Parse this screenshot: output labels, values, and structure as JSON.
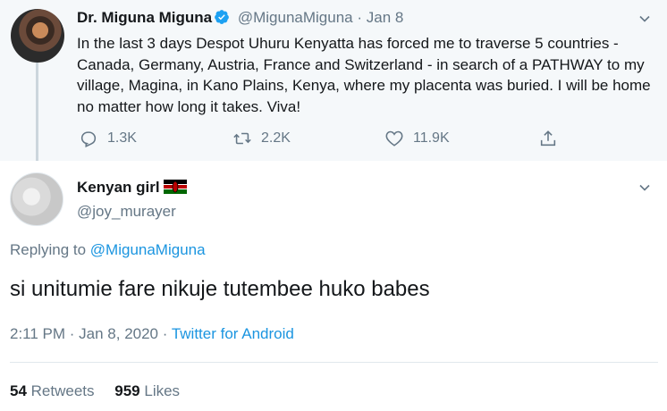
{
  "parent_tweet": {
    "author_name": "Dr. Miguna Miguna",
    "handle": "@MigunaMiguna",
    "separator": "·",
    "date": "Jan 8",
    "text": "In the last 3 days Despot Uhuru Kenyatta has forced me to traverse 5 countries - Canada, Germany, Austria, France and Switzerland - in search of a PATHWAY to my village, Magina, in Kano Plains, Kenya, where my placenta was buried. I will be home no matter how long it takes. Viva!",
    "replies": "1.3K",
    "retweets": "2.2K",
    "likes": "11.9K"
  },
  "reply_tweet": {
    "author_name": "Kenyan girl",
    "handle": "@joy_murayer",
    "replying_prefix": "Replying to",
    "replying_handle": "@MigunaMiguna",
    "text": "si unitumie fare nikuje tutembee huko babes",
    "time": "2:11 PM · Jan 8, 2020 ·",
    "source": "Twitter for Android",
    "retweets_count": "54",
    "retweets_label": "Retweets",
    "likes_count": "959",
    "likes_label": "Likes"
  },
  "colors": {
    "link": "#1b95e0",
    "muted": "#657786",
    "parent_bg": "#f5f8fa",
    "verified": "#1da1f2"
  },
  "icons": [
    "verified-badge-icon",
    "chevron-down-icon",
    "reply-icon",
    "retweet-icon",
    "like-icon",
    "share-icon",
    "kenya-flag-icon"
  ]
}
